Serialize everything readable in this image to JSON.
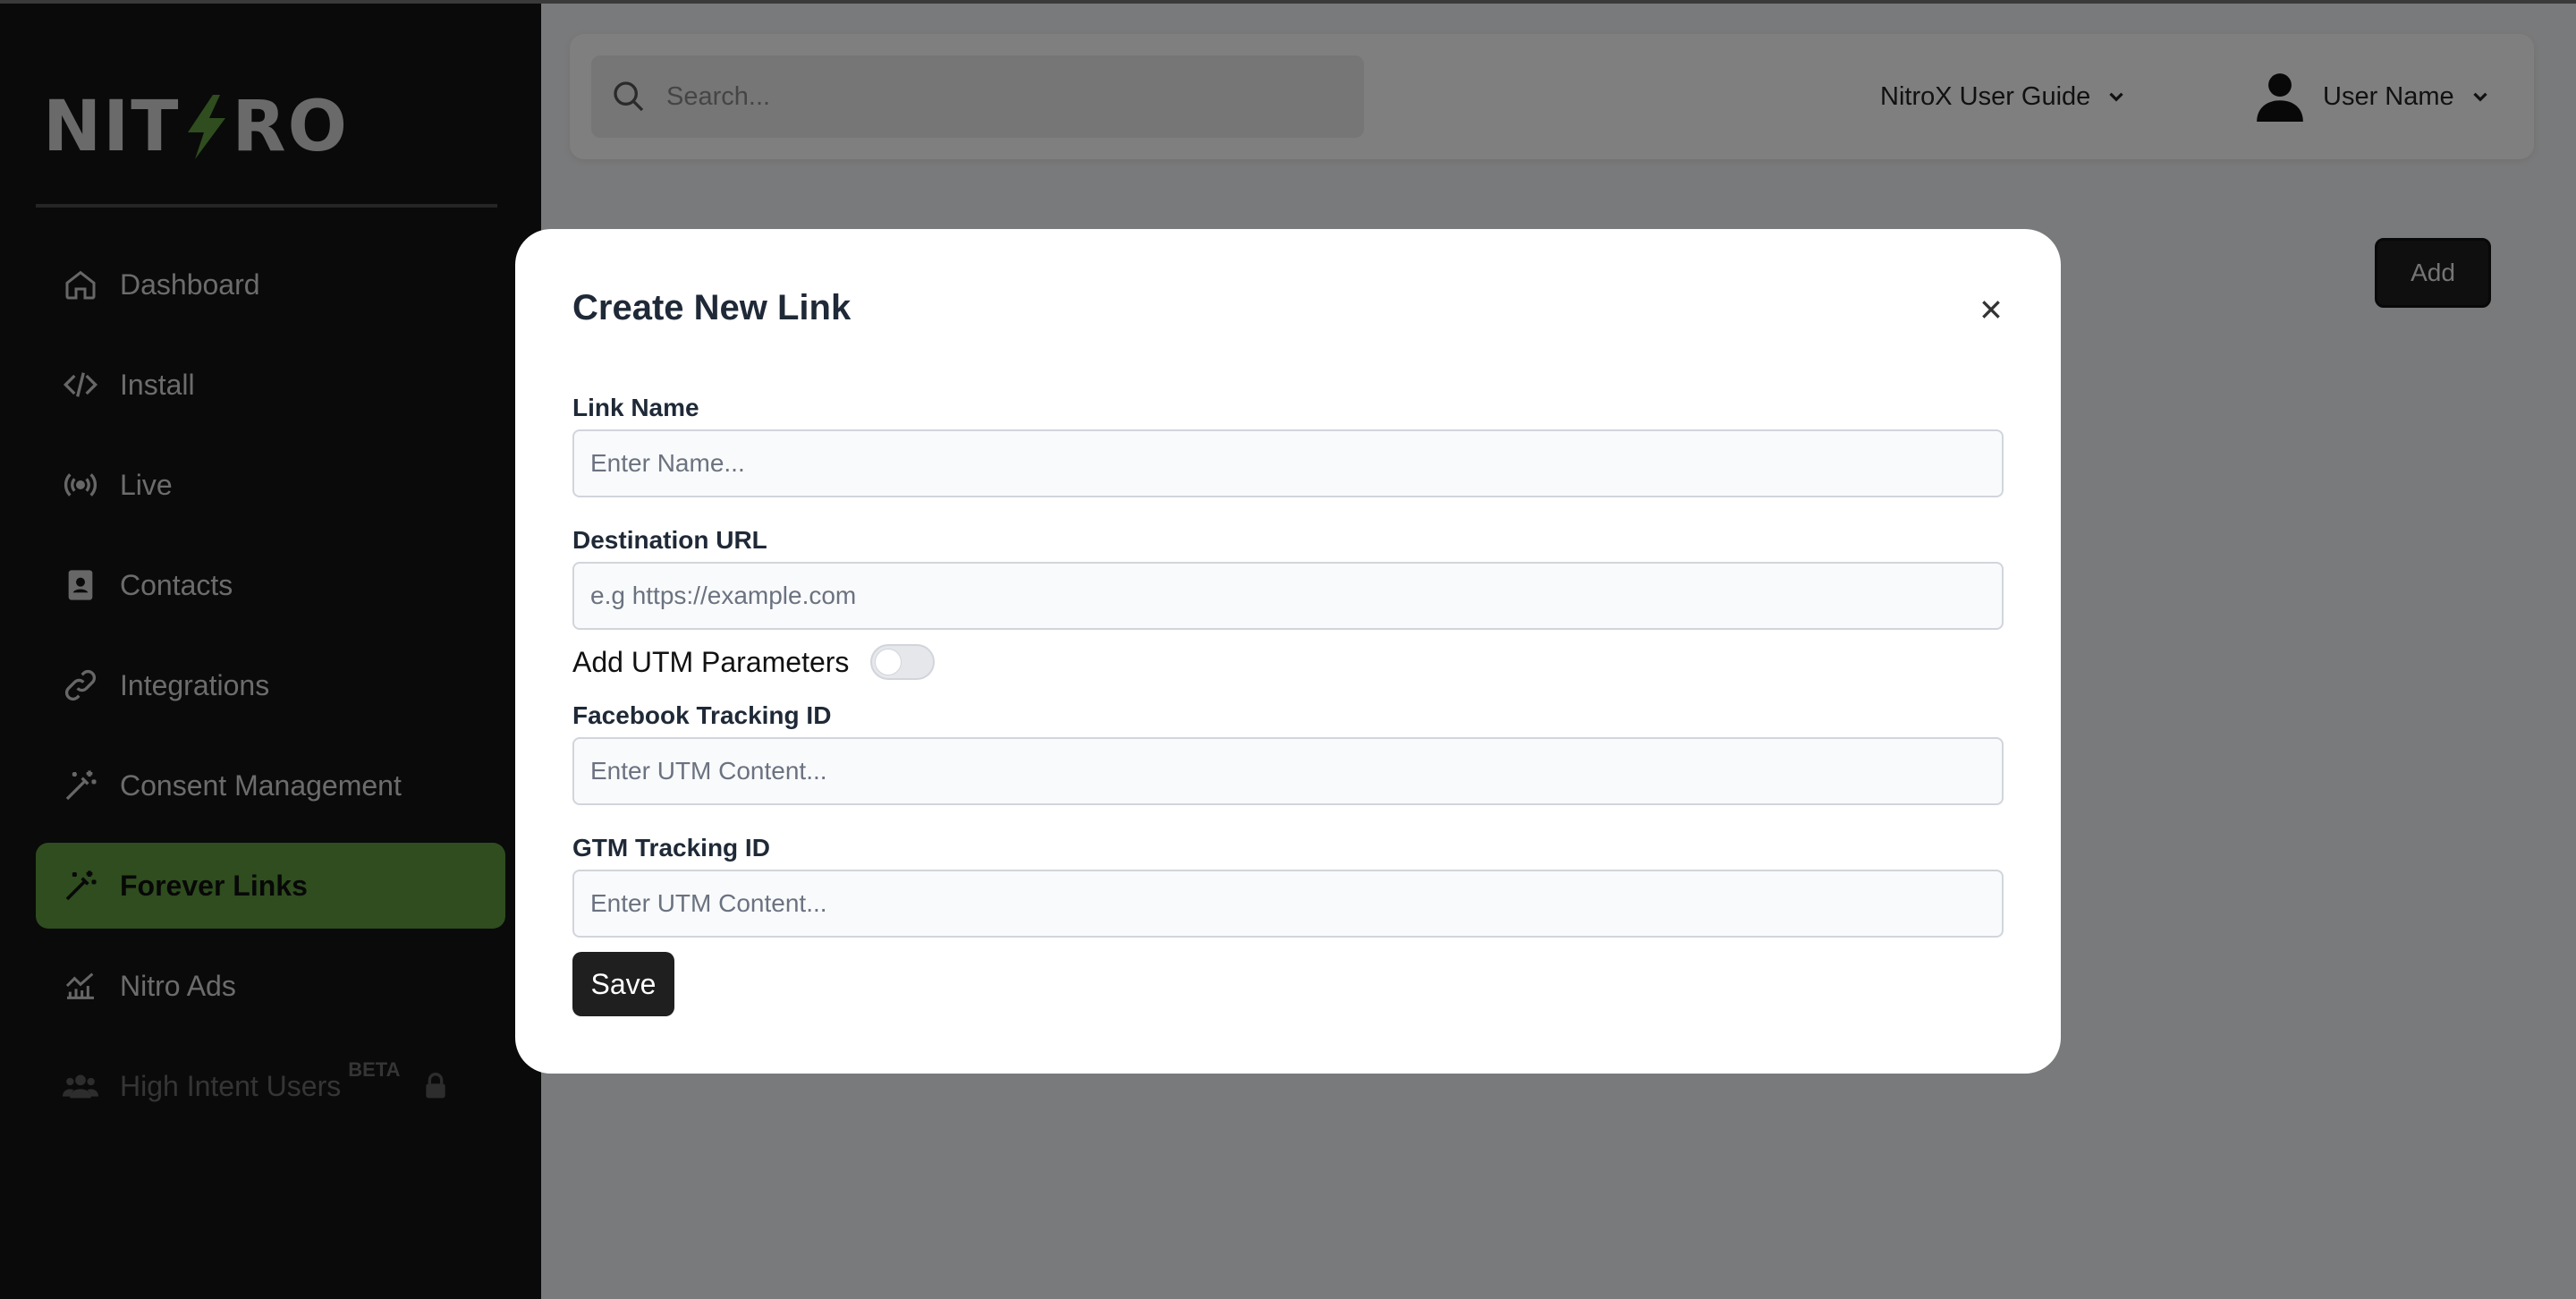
{
  "brand": {
    "logo_text_left": "NIT",
    "logo_text_right": "RO",
    "accent": "#5f9b3e"
  },
  "sidebar": {
    "items": [
      {
        "label": "Dashboard",
        "icon": "home-icon"
      },
      {
        "label": "Install",
        "icon": "code-icon"
      },
      {
        "label": "Live",
        "icon": "broadcast-icon"
      },
      {
        "label": "Contacts",
        "icon": "contact-book-icon"
      },
      {
        "label": "Integrations",
        "icon": "link-icon"
      },
      {
        "label": "Consent Management",
        "icon": "magic-wand-icon"
      },
      {
        "label": "Forever Links",
        "icon": "magic-wand-icon",
        "active": true
      },
      {
        "label": "Nitro Ads",
        "icon": "chart-icon"
      },
      {
        "label": "High Intent Users",
        "icon": "users-icon",
        "badge": "BETA",
        "locked": true
      }
    ]
  },
  "header": {
    "search_placeholder": "Search...",
    "guide_label": "NitroX User Guide",
    "user_name": "User Name"
  },
  "main": {
    "add_label": "Add"
  },
  "modal": {
    "title": "Create New Link",
    "close_icon": "close-icon",
    "link_name_label": "Link Name",
    "link_name_placeholder": "Enter Name...",
    "link_name_value": "",
    "destination_label": "Destination URL",
    "destination_placeholder": "e.g https://example.com",
    "destination_value": "",
    "utm_label": "Add UTM Parameters",
    "utm_enabled": false,
    "facebook_label": "Facebook Tracking ID",
    "facebook_placeholder": "Enter UTM Content...",
    "facebook_value": "",
    "gtm_label": "GTM Tracking ID",
    "gtm_placeholder": "Enter UTM Content...",
    "gtm_value": "",
    "save_label": "Save"
  }
}
